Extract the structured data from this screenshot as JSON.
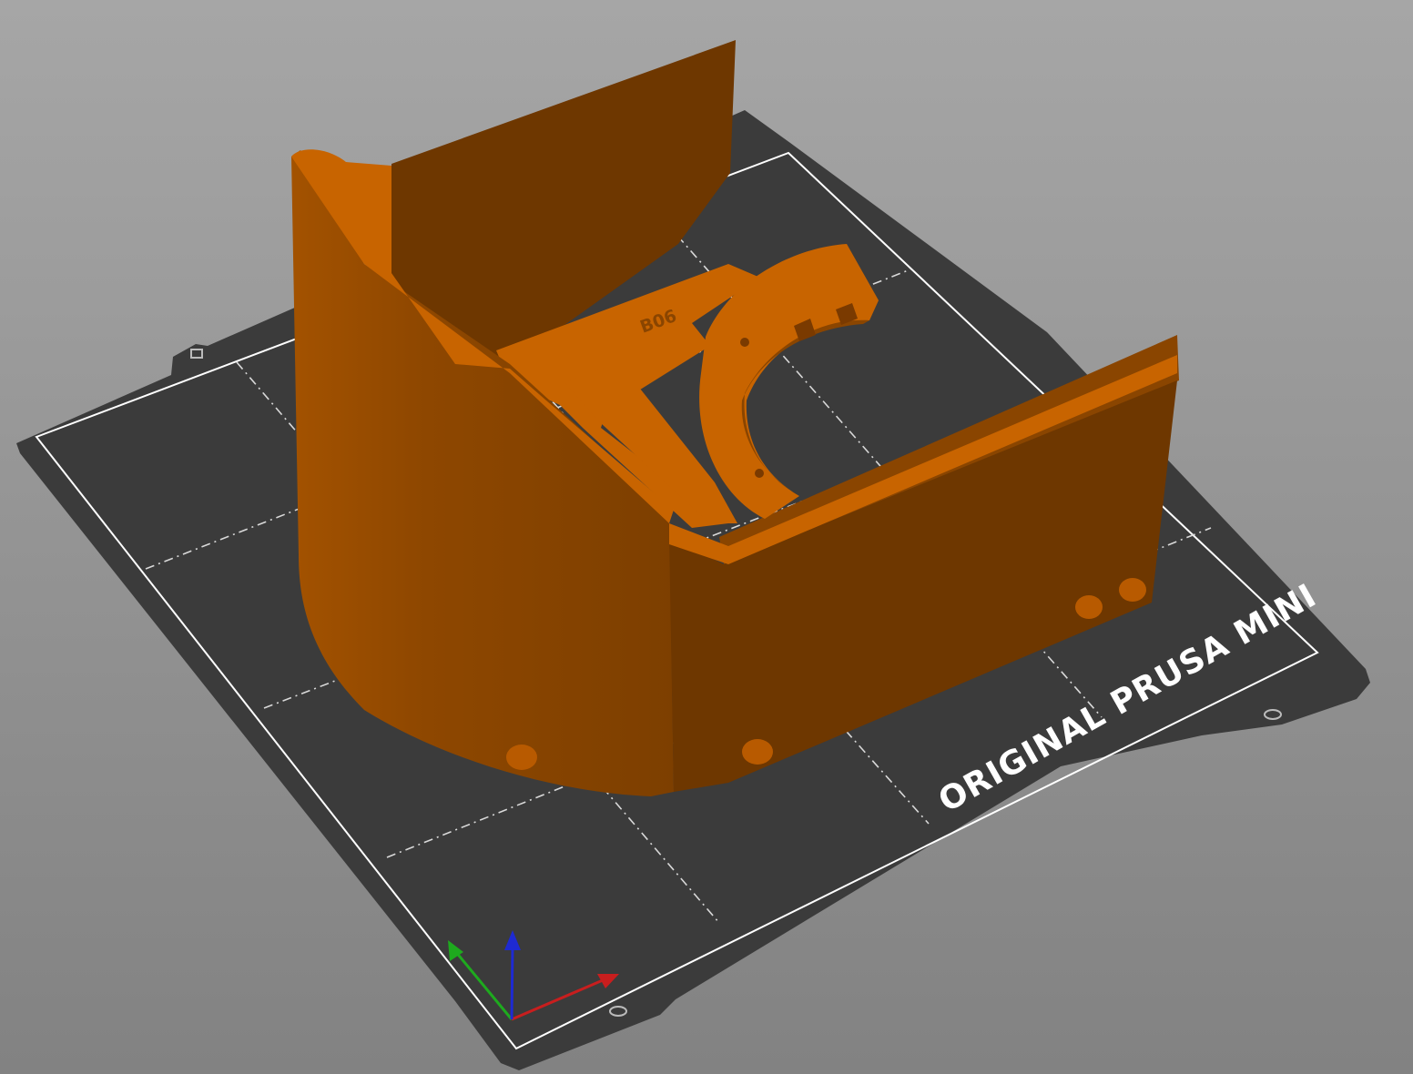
{
  "viewer": {
    "background_top": "#a6a6a6",
    "background_bottom": "#828282"
  },
  "bed": {
    "printer_label": "ORIGINAL PRUSA MINI",
    "sheet_color": "#3b3b3b",
    "outline_color": "#ffffff",
    "grid_color": "#d9d9d9"
  },
  "model": {
    "embossed_label": "B06",
    "color_light": "#c86400",
    "color_mid": "#8a4500",
    "color_dark": "#6e3700"
  },
  "axes": {
    "x_color": "#c81e1e",
    "y_color": "#1eaa1e",
    "z_color": "#1e2ad2"
  }
}
